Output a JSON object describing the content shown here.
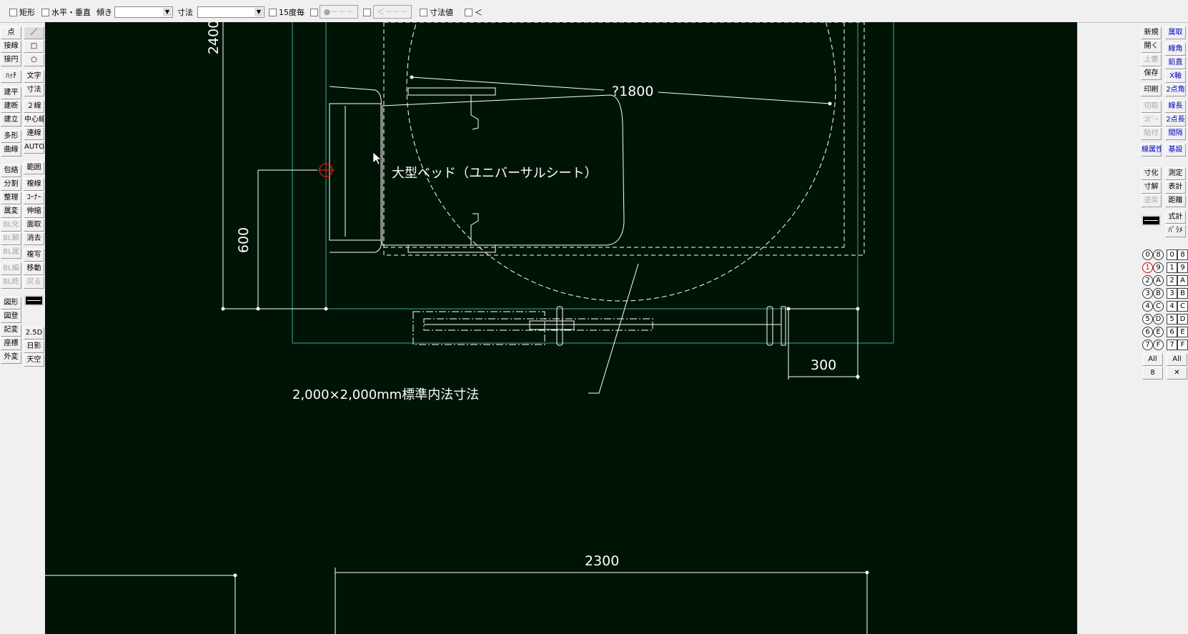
{
  "toolbar": {
    "rect_label": "矩形",
    "hv_label": "水平・垂直",
    "tilt_label": "傾き",
    "tilt_value": "",
    "dim_label": "寸法",
    "dim_value": "",
    "deg15_label": "15度毎",
    "pattern1_label": "●－－－",
    "pattern2_label": "＜－－－",
    "dimval_label": "寸法値",
    "lt_label": "＜"
  },
  "left_tools": {
    "col1": [
      "点",
      "接線",
      "接円",
      "ﾊｯﾁ",
      "建平",
      "建断",
      "建立",
      "多形",
      "曲線",
      "包絡",
      "分割",
      "整理",
      "属変",
      "BL化",
      "BL解",
      "BL属",
      "BL編",
      "BL終",
      "図形",
      "図登",
      "記変",
      "座標",
      "外変"
    ],
    "col2": [
      "／",
      "□",
      "○",
      "文字",
      "寸法",
      "２線",
      "中心線",
      "連線",
      "AUTO",
      "範囲",
      "複線",
      "ｺｰﾅｰ",
      "伸縮",
      "面取",
      "消去",
      "複写",
      "移動",
      "戻る",
      "2.5D",
      "日影",
      "天空"
    ]
  },
  "right_tools": {
    "col1": [
      "新規",
      "開く",
      "上書",
      "保存",
      "印刷",
      "切取",
      "ｺﾋﾟｰ",
      "貼付",
      "線属性",
      "寸化",
      "寸解",
      "逆戻"
    ],
    "col2": [
      "属取",
      "線角",
      "鉛直",
      "X軸",
      "2点角",
      "線長",
      "2点長",
      "間隔",
      "基設",
      "測定",
      "表計",
      "距離",
      "式計",
      "ﾊﾟﾗﾒ"
    ]
  },
  "layers": {
    "groups": [
      "0",
      "1",
      "2",
      "3",
      "4",
      "5",
      "6",
      "7",
      "8",
      "9",
      "A",
      "B",
      "C",
      "D",
      "E",
      "F"
    ],
    "layers": [
      "0",
      "1",
      "2",
      "3",
      "4",
      "5",
      "6",
      "7",
      "8",
      "9",
      "A",
      "B",
      "C",
      "D",
      "E",
      "F"
    ],
    "all_label": "All",
    "page_label": "8",
    "close_label": "✕"
  },
  "drawing": {
    "dim_2400": "2400",
    "dim_600": "600",
    "dim_1800": "?1800",
    "dim_300": "300",
    "dim_2300": "2300",
    "bed_label": "大型ベッド（ユニバーサルシート）",
    "note_label": "2,000×2,000mm標準内法寸法"
  },
  "colors": {
    "canvas_bg": "#001405",
    "wall_line": "#3fa0a8",
    "drawing_line": "#ffffff",
    "cursor_red": "#ff2020"
  },
  "icons": [
    "mouse-cursor-icon",
    "crosshair-icon",
    "chevron-down-icon"
  ]
}
